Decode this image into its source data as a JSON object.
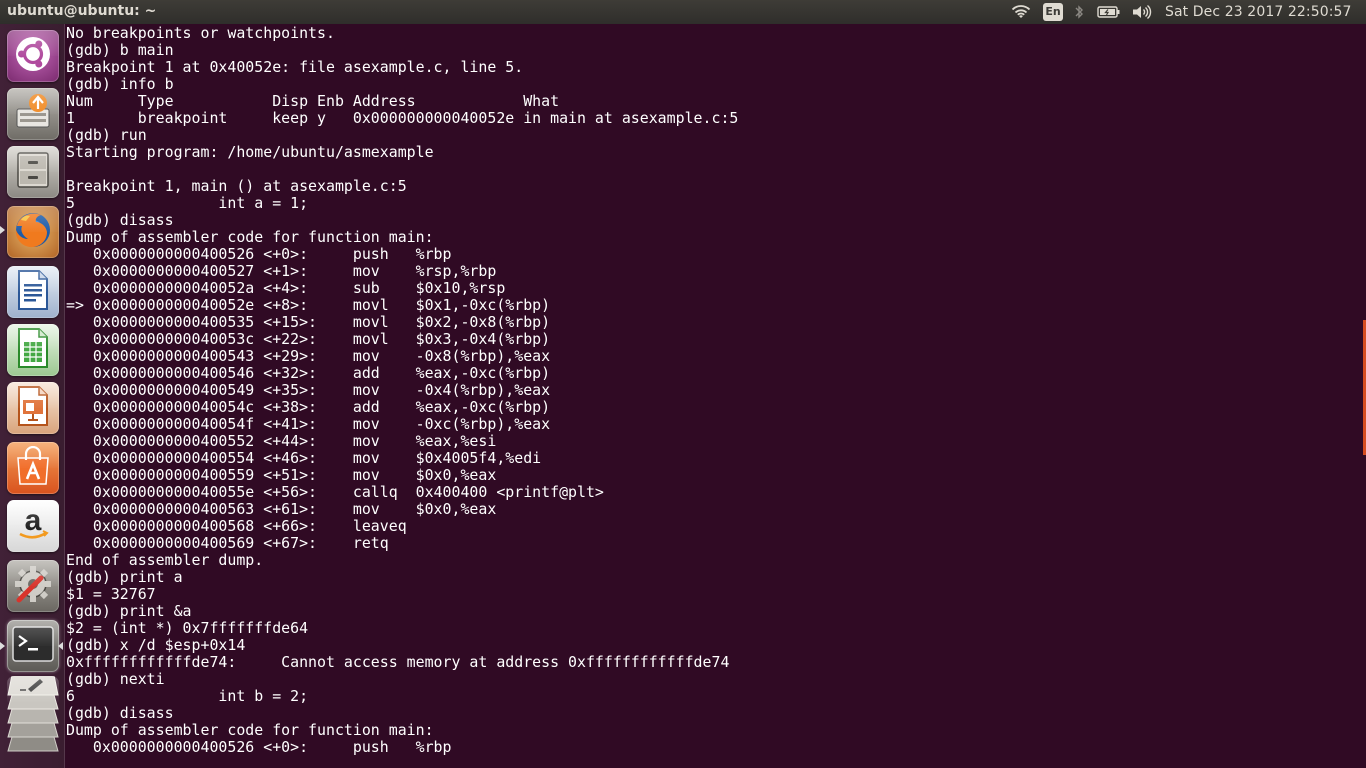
{
  "window": {
    "title": "ubuntu@ubuntu: ~"
  },
  "panel": {
    "language": "En",
    "clock": "Sat Dec 23 2017 22:50:57",
    "indicators": [
      "wifi-icon",
      "keyboard-language-icon",
      "bluetooth-icon",
      "battery-icon",
      "volume-icon"
    ]
  },
  "launcher": {
    "items": [
      {
        "name": "ubuntu-dash",
        "icon": "ubuntu-logo-icon"
      },
      {
        "name": "software-updater",
        "icon": "software-updater-icon"
      },
      {
        "name": "files",
        "icon": "file-cabinet-icon"
      },
      {
        "name": "firefox",
        "icon": "firefox-icon"
      },
      {
        "name": "libreoffice-writer",
        "icon": "writer-document-icon"
      },
      {
        "name": "libreoffice-calc",
        "icon": "calc-spreadsheet-icon"
      },
      {
        "name": "libreoffice-impress",
        "icon": "impress-presentation-icon"
      },
      {
        "name": "ubuntu-software",
        "icon": "shopping-bag-icon"
      },
      {
        "name": "amazon",
        "icon": "amazon-logo-icon"
      },
      {
        "name": "system-settings",
        "icon": "settings-gear-icon"
      },
      {
        "name": "terminal",
        "icon": "terminal-icon",
        "active": true
      },
      {
        "name": "workspaces",
        "icon": "workspace-switcher-icon"
      }
    ]
  },
  "terminal": {
    "lines": [
      "No breakpoints or watchpoints.",
      "(gdb) b main",
      "Breakpoint 1 at 0x40052e: file asexample.c, line 5.",
      "(gdb) info b",
      "Num     Type           Disp Enb Address            What",
      "1       breakpoint     keep y   0x000000000040052e in main at asexample.c:5",
      "(gdb) run",
      "Starting program: /home/ubuntu/asmexample",
      "",
      "Breakpoint 1, main () at asexample.c:5",
      "5                int a = 1;",
      "(gdb) disass",
      "Dump of assembler code for function main:",
      "   0x0000000000400526 <+0>:     push   %rbp",
      "   0x0000000000400527 <+1>:     mov    %rsp,%rbp",
      "   0x000000000040052a <+4>:     sub    $0x10,%rsp",
      "=> 0x000000000040052e <+8>:     movl   $0x1,-0xc(%rbp)",
      "   0x0000000000400535 <+15>:    movl   $0x2,-0x8(%rbp)",
      "   0x000000000040053c <+22>:    movl   $0x3,-0x4(%rbp)",
      "   0x0000000000400543 <+29>:    mov    -0x8(%rbp),%eax",
      "   0x0000000000400546 <+32>:    add    %eax,-0xc(%rbp)",
      "   0x0000000000400549 <+35>:    mov    -0x4(%rbp),%eax",
      "   0x000000000040054c <+38>:    add    %eax,-0xc(%rbp)",
      "   0x000000000040054f <+41>:    mov    -0xc(%rbp),%eax",
      "   0x0000000000400552 <+44>:    mov    %eax,%esi",
      "   0x0000000000400554 <+46>:    mov    $0x4005f4,%edi",
      "   0x0000000000400559 <+51>:    mov    $0x0,%eax",
      "   0x000000000040055e <+56>:    callq  0x400400 <printf@plt>",
      "   0x0000000000400563 <+61>:    mov    $0x0,%eax",
      "   0x0000000000400568 <+66>:    leaveq",
      "   0x0000000000400569 <+67>:    retq",
      "End of assembler dump.",
      "(gdb) print a",
      "$1 = 32767",
      "(gdb) print &a",
      "$2 = (int *) 0x7fffffffde64",
      "(gdb) x /d $esp+0x14",
      "0xffffffffffffde74:     Cannot access memory at address 0xffffffffffffde74",
      "(gdb) nexti",
      "6                int b = 2;",
      "(gdb) disass",
      "Dump of assembler code for function main:",
      "   0x0000000000400526 <+0>:     push   %rbp"
    ]
  }
}
